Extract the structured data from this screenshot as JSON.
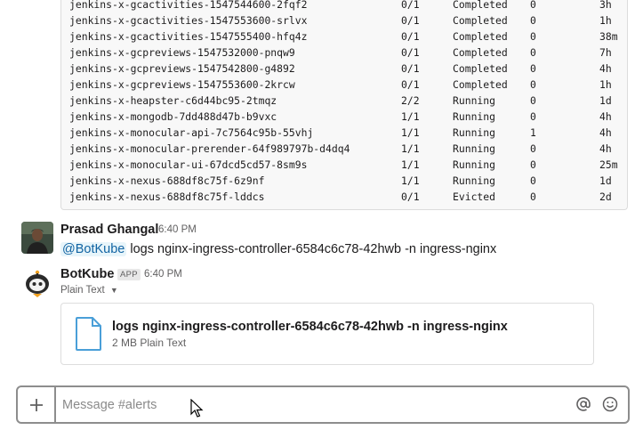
{
  "pods": [
    {
      "name": "jenkins-x-gcactivities-1547544600-2fqf2",
      "ready": "0/1",
      "status": "Completed",
      "restarts": "0",
      "age": "3h"
    },
    {
      "name": "jenkins-x-gcactivities-1547553600-srlvx",
      "ready": "0/1",
      "status": "Completed",
      "restarts": "0",
      "age": "1h"
    },
    {
      "name": "jenkins-x-gcactivities-1547555400-hfq4z",
      "ready": "0/1",
      "status": "Completed",
      "restarts": "0",
      "age": "38m"
    },
    {
      "name": "jenkins-x-gcpreviews-1547532000-pnqw9",
      "ready": "0/1",
      "status": "Completed",
      "restarts": "0",
      "age": "7h"
    },
    {
      "name": "jenkins-x-gcpreviews-1547542800-g4892",
      "ready": "0/1",
      "status": "Completed",
      "restarts": "0",
      "age": "4h"
    },
    {
      "name": "jenkins-x-gcpreviews-1547553600-2krcw",
      "ready": "0/1",
      "status": "Completed",
      "restarts": "0",
      "age": "1h"
    },
    {
      "name": "jenkins-x-heapster-c6d44bc95-2tmqz",
      "ready": "2/2",
      "status": "Running",
      "restarts": "0",
      "age": "1d"
    },
    {
      "name": "jenkins-x-mongodb-7dd488d47b-b9vxc",
      "ready": "1/1",
      "status": "Running",
      "restarts": "0",
      "age": "4h"
    },
    {
      "name": "jenkins-x-monocular-api-7c7564c95b-55vhj",
      "ready": "1/1",
      "status": "Running",
      "restarts": "1",
      "age": "4h"
    },
    {
      "name": "jenkins-x-monocular-prerender-64f989797b-d4dq4",
      "ready": "1/1",
      "status": "Running",
      "restarts": "0",
      "age": "4h"
    },
    {
      "name": "jenkins-x-monocular-ui-67dcd5cd57-8sm9s",
      "ready": "1/1",
      "status": "Running",
      "restarts": "0",
      "age": "25m"
    },
    {
      "name": "jenkins-x-nexus-688df8c75f-6z9nf",
      "ready": "1/1",
      "status": "Running",
      "restarts": "0",
      "age": "1d"
    },
    {
      "name": "jenkins-x-nexus-688df8c75f-lddcs",
      "ready": "0/1",
      "status": "Evicted",
      "restarts": "0",
      "age": "2d"
    }
  ],
  "message_user": {
    "sender": "Prasad Ghangal",
    "time": "6:40 PM",
    "mention": "@BotKube",
    "text": "logs nginx-ingress-controller-6584c6c78-42hwb -n ingress-nginx"
  },
  "message_bot": {
    "sender": "BotKube",
    "badge": "APP",
    "time": "6:40 PM",
    "subtype": "Plain Text",
    "file_name": "logs nginx-ingress-controller-6584c6c78-42hwb -n ingress-nginx",
    "file_meta": "2 MB Plain Text"
  },
  "composer": {
    "placeholder": "Message #alerts",
    "add_icon": "plus-icon",
    "mention_icon": "at-sign-icon",
    "emoji_icon": "smiley-icon"
  },
  "colors": {
    "mention_text": "#1264a3",
    "mention_bg": "#e8f5fa",
    "file_icon": "#4a9fd8",
    "composer_border": "#8d8d8d"
  }
}
